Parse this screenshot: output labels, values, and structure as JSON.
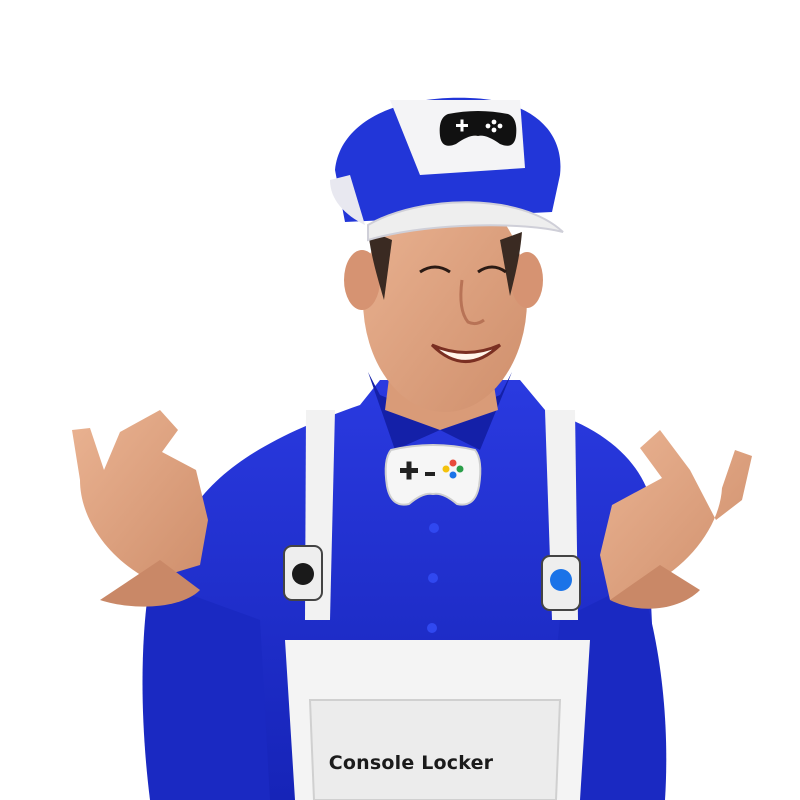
{
  "photo": {
    "subject": "person-in-gaming-costume",
    "apron_text": "Console Locker",
    "colors": {
      "shirt": "#1f2fd0",
      "cap": "#2030d8",
      "apron": "#f4f4f4",
      "skin": "#e0a07c",
      "background": "#ffffff",
      "button_blue": "#1a73e8"
    },
    "icons": {
      "cap_badge": "gamepad-icon",
      "bowtie": "gamepad-icon"
    }
  }
}
